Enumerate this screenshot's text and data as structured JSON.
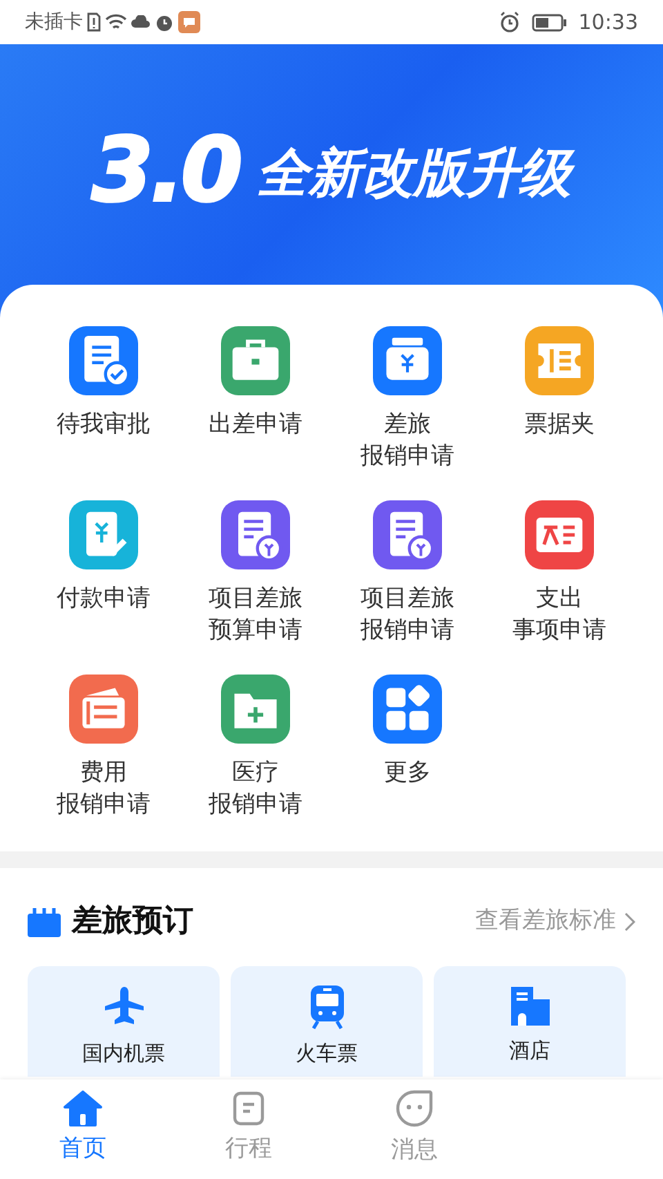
{
  "status_bar": {
    "carrier": "未插卡",
    "time": "10:33"
  },
  "banner": {
    "version": "3.0",
    "title": "全新改版升级"
  },
  "apps": [
    {
      "label": [
        "待我审批"
      ],
      "kind": "approval",
      "color": "#1677ff"
    },
    {
      "label": [
        "出差申请"
      ],
      "kind": "briefcase",
      "color": "#3aa76d"
    },
    {
      "label": [
        "差旅",
        "报销申请"
      ],
      "kind": "wallet",
      "color": "#1677ff"
    },
    {
      "label": [
        "票据夹"
      ],
      "kind": "ticket",
      "color": "#f5a623"
    },
    {
      "label": [
        "付款申请"
      ],
      "kind": "payment",
      "color": "#17b3d9"
    },
    {
      "label": [
        "项目差旅",
        "预算申请"
      ],
      "kind": "budget",
      "color": "#7059f0"
    },
    {
      "label": [
        "项目差旅",
        "报销申请"
      ],
      "kind": "reimburse",
      "color": "#7059f0"
    },
    {
      "label": [
        "支出",
        "事项申请"
      ],
      "kind": "expense",
      "color": "#ef4545"
    },
    {
      "label": [
        "费用",
        "报销申请"
      ],
      "kind": "fee",
      "color": "#f26b4e"
    },
    {
      "label": [
        "医疗",
        "报销申请"
      ],
      "kind": "medical",
      "color": "#3aa76d"
    },
    {
      "label": [
        "更多"
      ],
      "kind": "more",
      "color": "#1677ff"
    }
  ],
  "travel": {
    "title": "差旅预订",
    "link": "查看差旅标准",
    "items": [
      {
        "label": "国内机票",
        "kind": "plane"
      },
      {
        "label": "火车票",
        "kind": "train"
      },
      {
        "label": "酒店",
        "kind": "hotel"
      }
    ]
  },
  "tabs": [
    {
      "label": "首页",
      "kind": "home",
      "selected": true
    },
    {
      "label": "行程",
      "kind": "trip",
      "selected": false
    },
    {
      "label": "消息",
      "kind": "message",
      "selected": false
    }
  ]
}
